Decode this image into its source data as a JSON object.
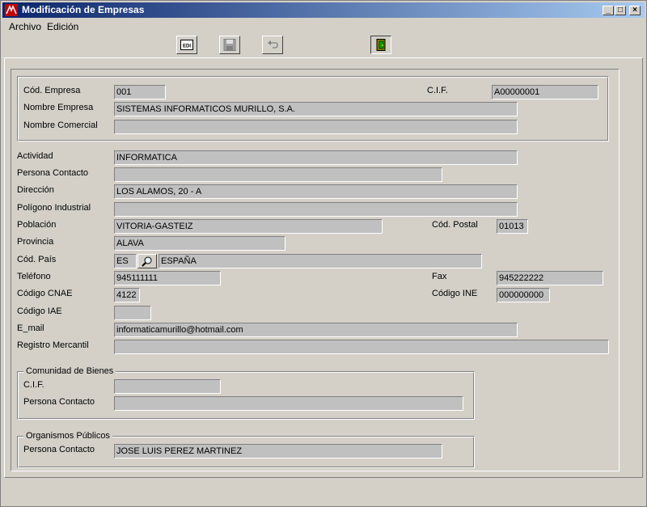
{
  "window": {
    "title": "Modificación de Empresas",
    "min_glyph": "_",
    "max_glyph": "□",
    "close_glyph": "×"
  },
  "menu": {
    "archivo": "Archivo",
    "edicion": "Edición"
  },
  "toolbar": {
    "edit_icon_text": "EDI"
  },
  "empresa": {
    "cod_label": "Cód. Empresa",
    "cod_value": "001",
    "cif_label": "C.I.F.",
    "cif_value": "A00000001",
    "nombre_label": "Nombre Empresa",
    "nombre_value": "SISTEMAS INFORMATICOS MURILLO, S.A.",
    "comercial_label": "Nombre Comercial",
    "comercial_value": ""
  },
  "datos": {
    "actividad_label": "Actividad",
    "actividad_value": "INFORMATICA",
    "contacto_label": "Persona Contacto",
    "contacto_value": "",
    "direccion_label": "Dirección",
    "direccion_value": "LOS ALAMOS, 20 - A",
    "poligono_label": "Polígono Industrial",
    "poligono_value": "",
    "poblacion_label": "Población",
    "poblacion_value": "VITORIA-GASTEIZ",
    "cp_label": "Cód. Postal",
    "cp_value": "01013",
    "provincia_label": "Provincia",
    "provincia_value": "ALAVA",
    "pais_label": "Cód. País",
    "pais_code": "ES",
    "pais_name": "ESPAÑA",
    "telefono_label": "Teléfono",
    "telefono_value": "945111111",
    "fax_label": "Fax",
    "fax_value": "945222222",
    "cnae_label": "Código CNAE",
    "cnae_value": "4122",
    "ine_label": "Código INE",
    "ine_value": "000000000",
    "iae_label": "Código IAE",
    "iae_value": "",
    "email_label": "E_mail",
    "email_value": "informaticamurillo@hotmail.com",
    "registro_label": "Registro Mercantil",
    "registro_value": ""
  },
  "comunidad": {
    "legend": "Comunidad de Bienes",
    "cif_label": "C.I.F.",
    "cif_value": "",
    "contacto_label": "Persona Contacto",
    "contacto_value": ""
  },
  "organismos": {
    "legend": "Organismos Públicos",
    "contacto_label": "Persona Contacto",
    "contacto_value": "JOSE LUIS PEREZ MARTINEZ"
  }
}
